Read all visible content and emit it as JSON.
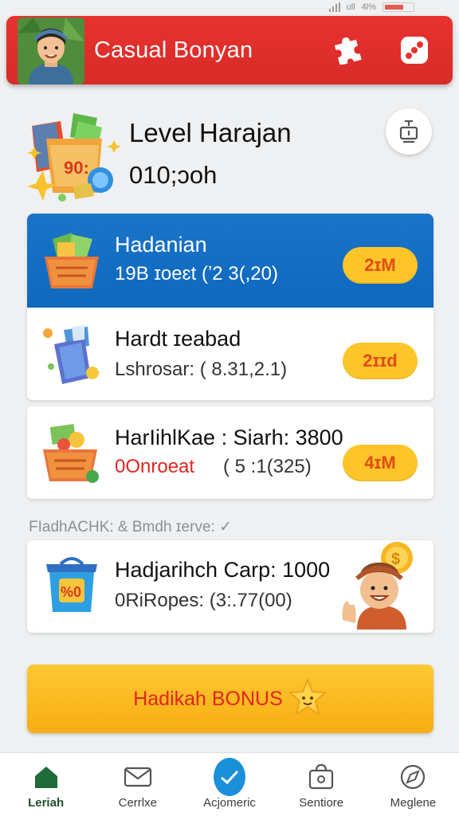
{
  "status": {
    "signal_text": "ull",
    "battery_text": "4l%"
  },
  "header": {
    "title": "Casual Bonyan"
  },
  "level": {
    "title": "Level Harajan",
    "value": "010;ɔoh"
  },
  "cards": [
    {
      "title": "Hadanian",
      "subtitle": "19B ɪoeɛt (ʼ2 3(,20)",
      "badge": "2ɪM"
    },
    {
      "title": "Hardt ɪeabad",
      "subtitle": "Lshrosar: ( 8.31,2.1)",
      "badge": "2ɪɪd"
    },
    {
      "title": "HarIihlKae : Siarh: 3800",
      "subtitle": "0Onroeat",
      "subtitle_tail": "( 5 :1(325)",
      "badge": "4ɪM"
    }
  ],
  "section_label": "FIadhACHK: & Bmdh ɪerve: ✓",
  "promo_card": {
    "title": "Hadjarihch Carp: 1000",
    "subtitle": "0RiRopes: (3:.77(00)"
  },
  "bonus": {
    "label": "Hadikah BONUS"
  },
  "nav": [
    {
      "label": "Leriah",
      "icon": "home-icon"
    },
    {
      "label": "Cerrlxe",
      "icon": "mail-icon"
    },
    {
      "label": "Acjomeric",
      "icon": "check-icon"
    },
    {
      "label": "Sentiore",
      "icon": "bag-icon"
    },
    {
      "label": "Meglene",
      "icon": "compass-icon"
    }
  ],
  "colors": {
    "header_red": "#e7322f",
    "card_blue": "#1a74c8",
    "pill_yellow": "#fdc52a",
    "bonus_yellow": "#fdc832",
    "nav_blue": "#1990d8",
    "home_green": "#1f6b3a"
  }
}
